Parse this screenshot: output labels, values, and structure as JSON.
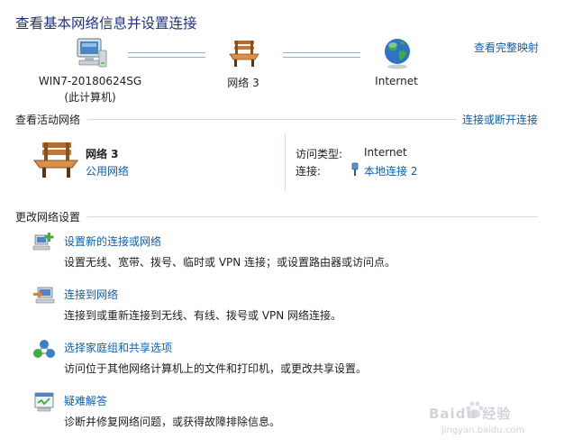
{
  "header": {
    "title": "查看基本网络信息并设置连接",
    "view_full_map": "查看完整映射"
  },
  "network_map": {
    "computer": {
      "name": "WIN7-20180624SG",
      "sub": "(此计算机)"
    },
    "network": {
      "name": "网络  3"
    },
    "internet": {
      "name": "Internet"
    }
  },
  "active_networks": {
    "heading": "查看活动网络",
    "connect_disconnect": "连接或断开连接",
    "network_name": "网络  3",
    "network_type": "公用网络",
    "access_type_label": "访问类型:",
    "access_type_value": "Internet",
    "connection_label": "连接:",
    "connection_value": "本地连接 2"
  },
  "change_settings": {
    "heading": "更改网络设置",
    "tasks": [
      {
        "title": "设置新的连接或网络",
        "desc": "设置无线、宽带、拨号、临时或 VPN 连接；或设置路由器或访问点。",
        "icon": "new-connection-icon"
      },
      {
        "title": "连接到网络",
        "desc": "连接到或重新连接到无线、有线、拨号或 VPN 网络连接。",
        "icon": "connect-network-icon"
      },
      {
        "title": "选择家庭组和共享选项",
        "desc": "访问位于其他网络计算机上的文件和打印机，或更改共享设置。",
        "icon": "homegroup-icon"
      },
      {
        "title": "疑难解答",
        "desc": "诊断并修复网络问题，或获得故障排除信息。",
        "icon": "troubleshoot-icon"
      }
    ]
  },
  "watermark": {
    "brand": "Baidu 经验",
    "site": "jingyan.baidu.com"
  }
}
